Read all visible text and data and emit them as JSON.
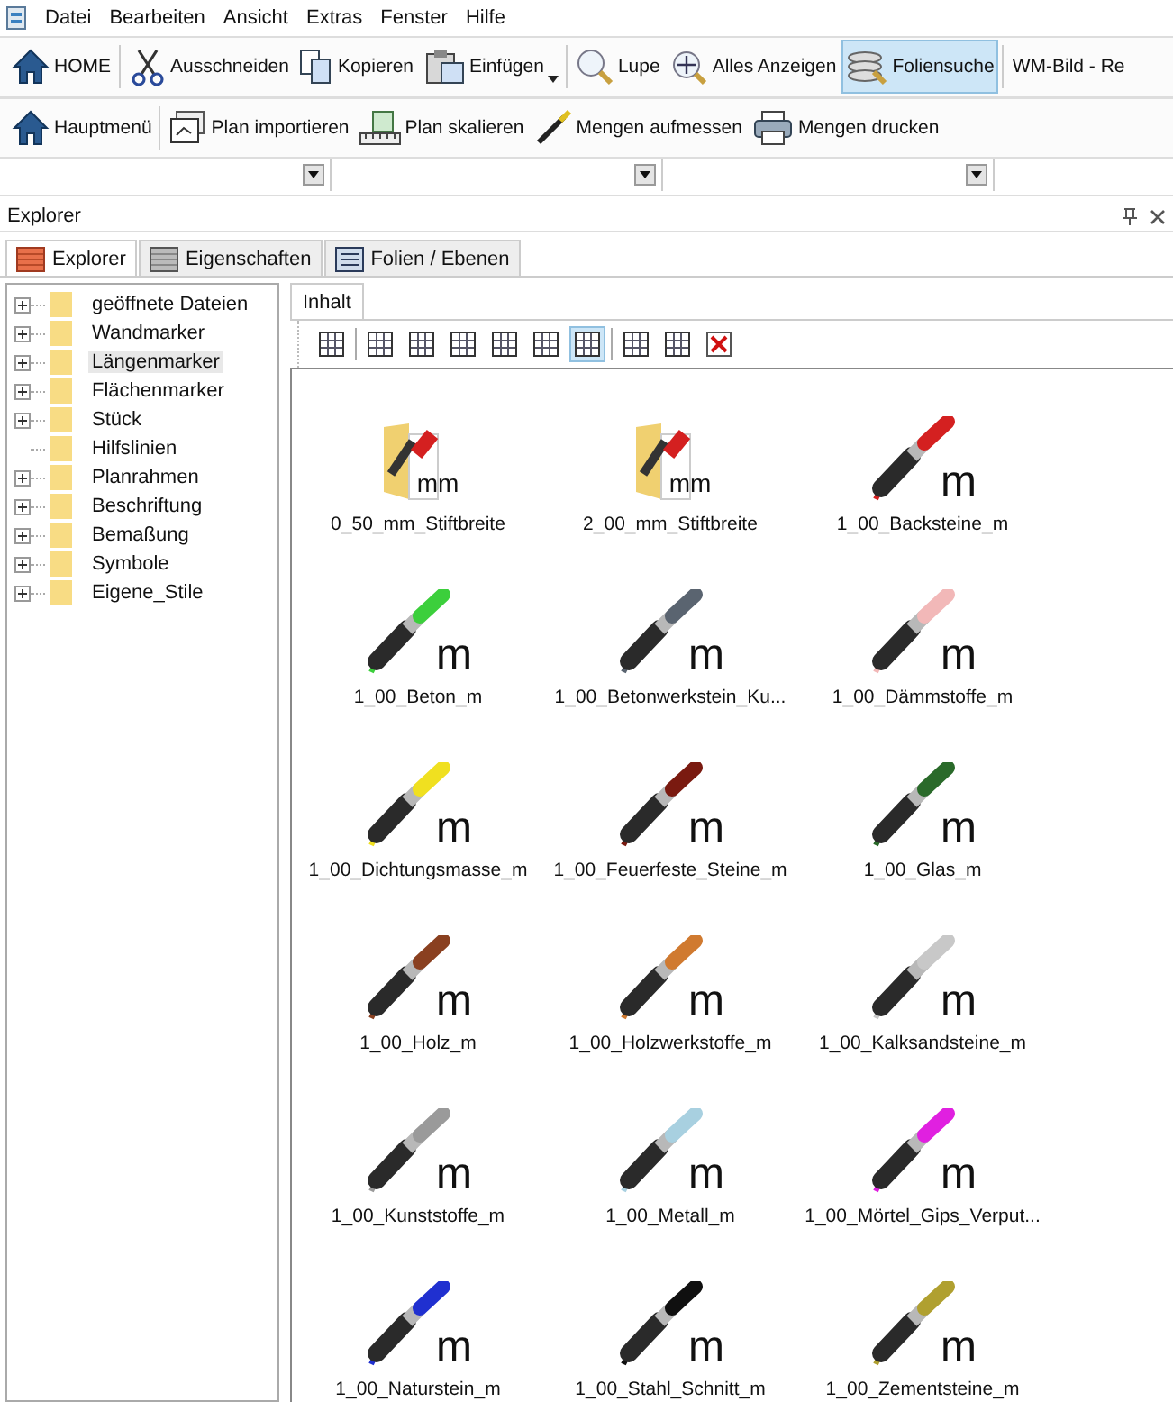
{
  "menu": [
    "Datei",
    "Bearbeiten",
    "Ansicht",
    "Extras",
    "Fenster",
    "Hilfe"
  ],
  "toolbar_1": [
    {
      "label": "HOME",
      "selected": false,
      "dropdown": false
    },
    {
      "label": "Ausschneiden",
      "selected": false,
      "dropdown": false
    },
    {
      "label": "Kopieren",
      "selected": false,
      "dropdown": false
    },
    {
      "label": "Einfügen",
      "selected": false,
      "dropdown": true
    },
    {
      "label": "Lupe",
      "selected": false,
      "dropdown": false
    },
    {
      "label": "Alles Anzeigen",
      "selected": false,
      "dropdown": false
    },
    {
      "label": "Foliensuche",
      "selected": true,
      "dropdown": false
    }
  ],
  "window_title": "WM-Bild - Re",
  "toolbar_2": [
    "Hauptmenü",
    "Plan importieren",
    "Plan skalieren",
    "Mengen aufmessen",
    "Mengen drucken"
  ],
  "explorer": {
    "title": "Explorer",
    "tabs": [
      {
        "label": "Explorer",
        "selected": true
      },
      {
        "label": "Eigenschaften",
        "selected": false
      },
      {
        "label": "Folien / Ebenen",
        "selected": false
      }
    ],
    "tree": [
      {
        "label": "geöffnete Dateien",
        "expandable": true,
        "selected": false
      },
      {
        "label": "Wandmarker",
        "expandable": true,
        "selected": false
      },
      {
        "label": "Längenmarker",
        "expandable": true,
        "selected": true
      },
      {
        "label": "Flächenmarker",
        "expandable": true,
        "selected": false
      },
      {
        "label": "Stück",
        "expandable": true,
        "selected": false
      },
      {
        "label": "Hilfslinien",
        "expandable": false,
        "selected": false
      },
      {
        "label": "Planrahmen",
        "expandable": true,
        "selected": false
      },
      {
        "label": "Beschriftung",
        "expandable": true,
        "selected": false
      },
      {
        "label": "Bemaßung",
        "expandable": true,
        "selected": false
      },
      {
        "label": "Symbole",
        "expandable": true,
        "selected": false
      },
      {
        "label": "Eigene_Stile",
        "expandable": true,
        "selected": false
      }
    ]
  },
  "content": {
    "tab": "Inhalt",
    "view_buttons": [
      {
        "selected": false
      },
      {
        "selected": false
      },
      {
        "selected": false
      },
      {
        "selected": false
      },
      {
        "selected": false
      },
      {
        "selected": false
      },
      {
        "selected": true
      },
      {
        "selected": false
      },
      {
        "selected": false
      },
      {
        "selected": false
      }
    ],
    "items": [
      {
        "kind": "folder",
        "name": "0_50_mm_Stiftbreite",
        "unit": "mm",
        "color": "#d42020"
      },
      {
        "kind": "folder",
        "name": "2_00_mm_Stiftbreite",
        "unit": "mm",
        "color": "#d42020"
      },
      {
        "kind": "marker",
        "name": "1_00_Backsteine_m",
        "unit": "m",
        "color": "#d42020"
      },
      {
        "kind": "marker",
        "name": "1_00_Beton_m",
        "unit": "m",
        "color": "#3ccf3c"
      },
      {
        "kind": "marker",
        "name": "1_00_Betonwerkstein_Ku...",
        "unit": "m",
        "color": "#5a6470"
      },
      {
        "kind": "marker",
        "name": "1_00_Dämmstoffe_m",
        "unit": "m",
        "color": "#f2b8b8"
      },
      {
        "kind": "marker",
        "name": "1_00_Dichtungsmasse_m",
        "unit": "m",
        "color": "#f0e020"
      },
      {
        "kind": "marker",
        "name": "1_00_Feuerfeste_Steine_m",
        "unit": "m",
        "color": "#7a1a10"
      },
      {
        "kind": "marker",
        "name": "1_00_Glas_m",
        "unit": "m",
        "color": "#2a6a2a"
      },
      {
        "kind": "marker",
        "name": "1_00_Holz_m",
        "unit": "m",
        "color": "#8a4020"
      },
      {
        "kind": "marker",
        "name": "1_00_Holzwerkstoffe_m",
        "unit": "m",
        "color": "#d07a30"
      },
      {
        "kind": "marker",
        "name": "1_00_Kalksandsteine_m",
        "unit": "m",
        "color": "#c8c8c8"
      },
      {
        "kind": "marker",
        "name": "1_00_Kunststoffe_m",
        "unit": "m",
        "color": "#9a9a9a"
      },
      {
        "kind": "marker",
        "name": "1_00_Metall_m",
        "unit": "m",
        "color": "#a8d0e0"
      },
      {
        "kind": "marker",
        "name": "1_00_Mörtel_Gips_Verput...",
        "unit": "m",
        "color": "#e020e0"
      },
      {
        "kind": "marker",
        "name": "1_00_Naturstein_m",
        "unit": "m",
        "color": "#2030d0"
      },
      {
        "kind": "marker",
        "name": "1_00_Stahl_Schnitt_m",
        "unit": "m",
        "color": "#101010"
      },
      {
        "kind": "marker",
        "name": "1_00_Zementsteine_m",
        "unit": "m",
        "color": "#b0a030"
      }
    ]
  }
}
